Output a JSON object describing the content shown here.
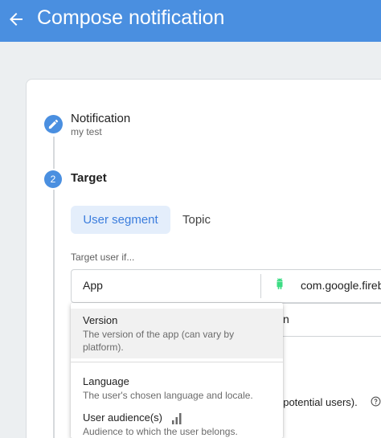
{
  "header": {
    "title": "Compose notification"
  },
  "steps": [
    {
      "label": "Notification",
      "subtitle": "my test"
    },
    {
      "number": "2",
      "label": "Target"
    }
  ],
  "tabs": [
    {
      "label": "User segment",
      "selected": true
    },
    {
      "label": "Topic",
      "selected": false
    }
  ],
  "targeting": {
    "label": "Target user if...",
    "field": "App",
    "app_id": "com.google.fireb",
    "row2_fragment": "n",
    "reach_fragment": "f potential users)."
  },
  "dropdown": {
    "items": [
      {
        "title": "Version",
        "description": "The version of the app (can vary by platform)."
      },
      {
        "title": "Language",
        "description": "The user's chosen language and locale."
      },
      {
        "title": "User audience(s)",
        "description": "Audience to which the user belongs."
      }
    ]
  },
  "icons": {
    "back": "arrow-back-icon",
    "step1": "pencil-icon",
    "platform": "android-icon",
    "help": "help-icon",
    "audience": "bars-icon"
  },
  "colors": {
    "primary": "#4a8fe0",
    "tab_bg": "#e4eefb",
    "android": "#3ddc84"
  }
}
